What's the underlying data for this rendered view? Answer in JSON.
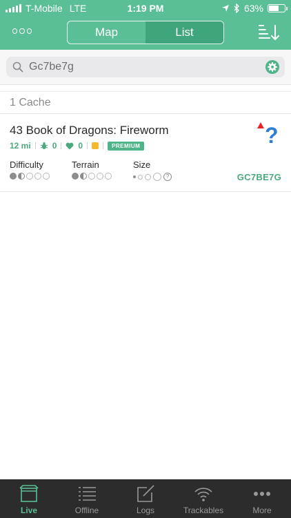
{
  "status_bar": {
    "carrier": "T-Mobile",
    "network": "LTE",
    "time": "1:19 PM",
    "battery": "63%",
    "battery_level": 0.63
  },
  "header": {
    "segments": [
      "Map",
      "List"
    ],
    "selected_segment": "List",
    "menu_icon": "ellipsis-icon",
    "sort_icon": "sort-icon"
  },
  "search": {
    "value": "Gc7be7g",
    "search_icon": "magnifier-icon",
    "filter_icon": "gear-icon"
  },
  "results": {
    "count_label": "1 Cache",
    "items": [
      {
        "title": "43 Book of Dragons: Fireworm",
        "distance": "12 mi",
        "trackables": "0",
        "favorites": "0",
        "badge": "PREMIUM",
        "difficulty_label": "Difficulty",
        "difficulty_value": 1.5,
        "terrain_label": "Terrain",
        "terrain_value": 1.5,
        "size_label": "Size",
        "size_value": "?",
        "code": "GC7BE7G",
        "type_icon": "mystery-cache-icon"
      }
    ]
  },
  "tabbar": {
    "tabs": [
      {
        "label": "Live",
        "icon": "live-box-icon",
        "active": true
      },
      {
        "label": "Offline",
        "icon": "list-icon",
        "active": false
      },
      {
        "label": "Logs",
        "icon": "compose-icon",
        "active": false
      },
      {
        "label": "Trackables",
        "icon": "wifi-icon",
        "active": false
      },
      {
        "label": "More",
        "icon": "more-icon",
        "active": false
      }
    ]
  },
  "colors": {
    "brand_green": "#5bbf95",
    "segment_active": "#3fa67c",
    "accent_text": "#4aaa7d",
    "tabbar_bg": "#2c2c2c",
    "mystery_blue": "#2e7fd6",
    "marker_red": "#e0262b"
  }
}
